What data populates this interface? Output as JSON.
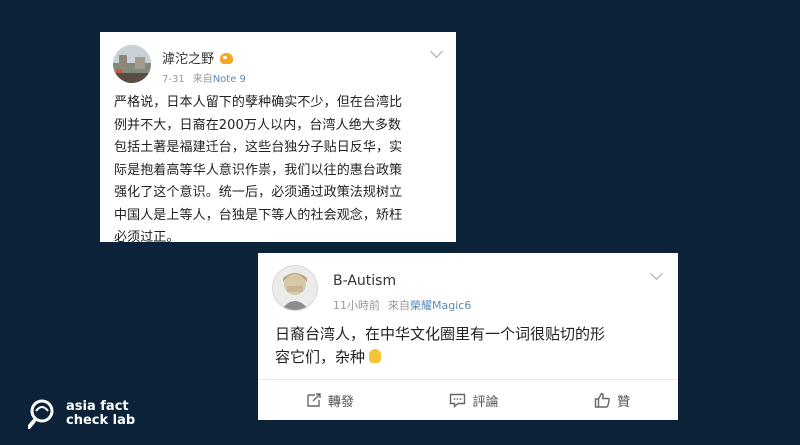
{
  "posts": [
    {
      "username": "滹沱之野",
      "date": "7-31",
      "source_prefix": "来自",
      "source_device": "Note 9",
      "text": "严格说，日本人留下的孽种确实不少，但在台湾比\n例并不大，日裔在200万人以内，台湾人绝大多数\n包括土著是福建迁台，这些台独分子贴日反华，实\n际是抱着高等华人意识作祟，我们以往的惠台政策\n强化了这个意识。统一后，必须通过政策法规树立\n中国人是上等人，台独是下等人的社会观念，矫枉\n必须过正。"
    },
    {
      "username": "B-Autism",
      "date": "11小時前",
      "source_prefix": "來自",
      "source_device": "榮耀Magic6",
      "text": "日裔台湾人，在中华文化圈里有一个词很贴切的形\n容它们，杂种",
      "actions": {
        "repost": "轉發",
        "comment": "評論",
        "like": "贊"
      }
    }
  ],
  "logo": {
    "line1": "asia fact",
    "line2": "check lab"
  },
  "colors": {
    "background": "#0b2239",
    "card": "#ffffff",
    "source_link": "#5b87b8"
  }
}
